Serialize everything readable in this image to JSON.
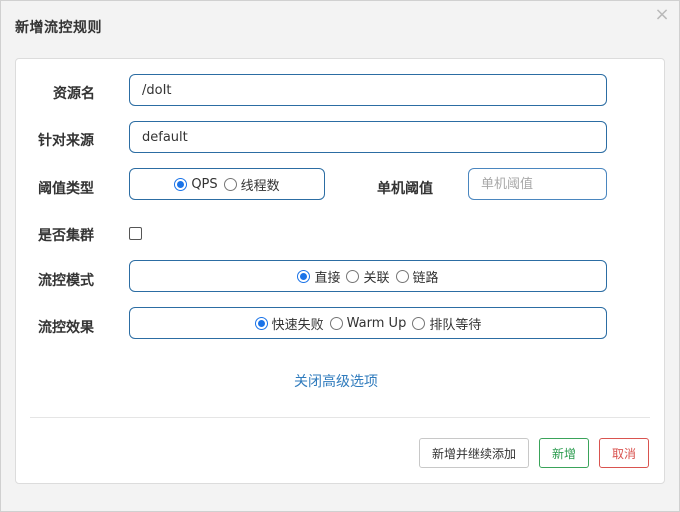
{
  "dialog": {
    "title": "新增流控规则",
    "close_symbol": "×"
  },
  "form": {
    "resource": {
      "label": "资源名",
      "value": "/doIt"
    },
    "limit_app": {
      "label": "针对来源",
      "value": "default"
    },
    "threshold_type": {
      "label": "阈值类型",
      "options": [
        {
          "label": "QPS",
          "checked": true
        },
        {
          "label": "线程数",
          "checked": false
        }
      ]
    },
    "single_threshold": {
      "label": "单机阈值",
      "placeholder": "单机阈值",
      "value": ""
    },
    "cluster": {
      "label": "是否集群",
      "checked": false
    },
    "control_mode": {
      "label": "流控模式",
      "options": [
        {
          "label": "直接",
          "checked": true
        },
        {
          "label": "关联",
          "checked": false
        },
        {
          "label": "链路",
          "checked": false
        }
      ]
    },
    "control_effect": {
      "label": "流控效果",
      "options": [
        {
          "label": "快速失败",
          "checked": true
        },
        {
          "label": "Warm Up",
          "checked": false
        },
        {
          "label": "排队等待",
          "checked": false
        }
      ]
    },
    "advanced_toggle": "关闭高级选项"
  },
  "footer": {
    "add_continue_label": "新增并继续添加",
    "add_label": "新增",
    "cancel_label": "取消"
  },
  "colors": {
    "input_border": "#2c6da3",
    "link": "#2f7bbd",
    "success": "#2a9b4e",
    "danger": "#d9534f",
    "radio_checked": "#1a73e8"
  }
}
